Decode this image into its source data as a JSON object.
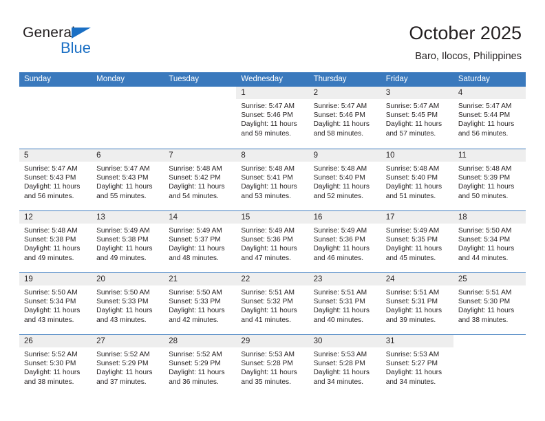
{
  "brand": {
    "name_part1": "General",
    "name_part2": "Blue",
    "triangle_color": "#1a6fc4",
    "text_color": "#231f20"
  },
  "header": {
    "title": "October 2025",
    "subtitle": "Baro, Ilocos, Philippines"
  },
  "theme": {
    "header_bar_color": "#3a79bd",
    "daynum_band_color": "#eeeeee",
    "text_color": "#231f20",
    "cell_background": "#ffffff"
  },
  "calendar": {
    "weekdays": [
      "Sunday",
      "Monday",
      "Tuesday",
      "Wednesday",
      "Thursday",
      "Friday",
      "Saturday"
    ],
    "labels": {
      "sunrise": "Sunrise:",
      "sunset": "Sunset:",
      "daylight": "Daylight:"
    },
    "weeks": [
      [
        {
          "day": "",
          "sunrise": "",
          "sunset": "",
          "daylight_line1": "",
          "daylight_line2": ""
        },
        {
          "day": "",
          "sunrise": "",
          "sunset": "",
          "daylight_line1": "",
          "daylight_line2": ""
        },
        {
          "day": "",
          "sunrise": "",
          "sunset": "",
          "daylight_line1": "",
          "daylight_line2": ""
        },
        {
          "day": "1",
          "sunrise": "Sunrise: 5:47 AM",
          "sunset": "Sunset: 5:46 PM",
          "daylight_line1": "Daylight: 11 hours",
          "daylight_line2": "and 59 minutes."
        },
        {
          "day": "2",
          "sunrise": "Sunrise: 5:47 AM",
          "sunset": "Sunset: 5:46 PM",
          "daylight_line1": "Daylight: 11 hours",
          "daylight_line2": "and 58 minutes."
        },
        {
          "day": "3",
          "sunrise": "Sunrise: 5:47 AM",
          "sunset": "Sunset: 5:45 PM",
          "daylight_line1": "Daylight: 11 hours",
          "daylight_line2": "and 57 minutes."
        },
        {
          "day": "4",
          "sunrise": "Sunrise: 5:47 AM",
          "sunset": "Sunset: 5:44 PM",
          "daylight_line1": "Daylight: 11 hours",
          "daylight_line2": "and 56 minutes."
        }
      ],
      [
        {
          "day": "5",
          "sunrise": "Sunrise: 5:47 AM",
          "sunset": "Sunset: 5:43 PM",
          "daylight_line1": "Daylight: 11 hours",
          "daylight_line2": "and 56 minutes."
        },
        {
          "day": "6",
          "sunrise": "Sunrise: 5:47 AM",
          "sunset": "Sunset: 5:43 PM",
          "daylight_line1": "Daylight: 11 hours",
          "daylight_line2": "and 55 minutes."
        },
        {
          "day": "7",
          "sunrise": "Sunrise: 5:48 AM",
          "sunset": "Sunset: 5:42 PM",
          "daylight_line1": "Daylight: 11 hours",
          "daylight_line2": "and 54 minutes."
        },
        {
          "day": "8",
          "sunrise": "Sunrise: 5:48 AM",
          "sunset": "Sunset: 5:41 PM",
          "daylight_line1": "Daylight: 11 hours",
          "daylight_line2": "and 53 minutes."
        },
        {
          "day": "9",
          "sunrise": "Sunrise: 5:48 AM",
          "sunset": "Sunset: 5:40 PM",
          "daylight_line1": "Daylight: 11 hours",
          "daylight_line2": "and 52 minutes."
        },
        {
          "day": "10",
          "sunrise": "Sunrise: 5:48 AM",
          "sunset": "Sunset: 5:40 PM",
          "daylight_line1": "Daylight: 11 hours",
          "daylight_line2": "and 51 minutes."
        },
        {
          "day": "11",
          "sunrise": "Sunrise: 5:48 AM",
          "sunset": "Sunset: 5:39 PM",
          "daylight_line1": "Daylight: 11 hours",
          "daylight_line2": "and 50 minutes."
        }
      ],
      [
        {
          "day": "12",
          "sunrise": "Sunrise: 5:48 AM",
          "sunset": "Sunset: 5:38 PM",
          "daylight_line1": "Daylight: 11 hours",
          "daylight_line2": "and 49 minutes."
        },
        {
          "day": "13",
          "sunrise": "Sunrise: 5:49 AM",
          "sunset": "Sunset: 5:38 PM",
          "daylight_line1": "Daylight: 11 hours",
          "daylight_line2": "and 49 minutes."
        },
        {
          "day": "14",
          "sunrise": "Sunrise: 5:49 AM",
          "sunset": "Sunset: 5:37 PM",
          "daylight_line1": "Daylight: 11 hours",
          "daylight_line2": "and 48 minutes."
        },
        {
          "day": "15",
          "sunrise": "Sunrise: 5:49 AM",
          "sunset": "Sunset: 5:36 PM",
          "daylight_line1": "Daylight: 11 hours",
          "daylight_line2": "and 47 minutes."
        },
        {
          "day": "16",
          "sunrise": "Sunrise: 5:49 AM",
          "sunset": "Sunset: 5:36 PM",
          "daylight_line1": "Daylight: 11 hours",
          "daylight_line2": "and 46 minutes."
        },
        {
          "day": "17",
          "sunrise": "Sunrise: 5:49 AM",
          "sunset": "Sunset: 5:35 PM",
          "daylight_line1": "Daylight: 11 hours",
          "daylight_line2": "and 45 minutes."
        },
        {
          "day": "18",
          "sunrise": "Sunrise: 5:50 AM",
          "sunset": "Sunset: 5:34 PM",
          "daylight_line1": "Daylight: 11 hours",
          "daylight_line2": "and 44 minutes."
        }
      ],
      [
        {
          "day": "19",
          "sunrise": "Sunrise: 5:50 AM",
          "sunset": "Sunset: 5:34 PM",
          "daylight_line1": "Daylight: 11 hours",
          "daylight_line2": "and 43 minutes."
        },
        {
          "day": "20",
          "sunrise": "Sunrise: 5:50 AM",
          "sunset": "Sunset: 5:33 PM",
          "daylight_line1": "Daylight: 11 hours",
          "daylight_line2": "and 43 minutes."
        },
        {
          "day": "21",
          "sunrise": "Sunrise: 5:50 AM",
          "sunset": "Sunset: 5:33 PM",
          "daylight_line1": "Daylight: 11 hours",
          "daylight_line2": "and 42 minutes."
        },
        {
          "day": "22",
          "sunrise": "Sunrise: 5:51 AM",
          "sunset": "Sunset: 5:32 PM",
          "daylight_line1": "Daylight: 11 hours",
          "daylight_line2": "and 41 minutes."
        },
        {
          "day": "23",
          "sunrise": "Sunrise: 5:51 AM",
          "sunset": "Sunset: 5:31 PM",
          "daylight_line1": "Daylight: 11 hours",
          "daylight_line2": "and 40 minutes."
        },
        {
          "day": "24",
          "sunrise": "Sunrise: 5:51 AM",
          "sunset": "Sunset: 5:31 PM",
          "daylight_line1": "Daylight: 11 hours",
          "daylight_line2": "and 39 minutes."
        },
        {
          "day": "25",
          "sunrise": "Sunrise: 5:51 AM",
          "sunset": "Sunset: 5:30 PM",
          "daylight_line1": "Daylight: 11 hours",
          "daylight_line2": "and 38 minutes."
        }
      ],
      [
        {
          "day": "26",
          "sunrise": "Sunrise: 5:52 AM",
          "sunset": "Sunset: 5:30 PM",
          "daylight_line1": "Daylight: 11 hours",
          "daylight_line2": "and 38 minutes."
        },
        {
          "day": "27",
          "sunrise": "Sunrise: 5:52 AM",
          "sunset": "Sunset: 5:29 PM",
          "daylight_line1": "Daylight: 11 hours",
          "daylight_line2": "and 37 minutes."
        },
        {
          "day": "28",
          "sunrise": "Sunrise: 5:52 AM",
          "sunset": "Sunset: 5:29 PM",
          "daylight_line1": "Daylight: 11 hours",
          "daylight_line2": "and 36 minutes."
        },
        {
          "day": "29",
          "sunrise": "Sunrise: 5:53 AM",
          "sunset": "Sunset: 5:28 PM",
          "daylight_line1": "Daylight: 11 hours",
          "daylight_line2": "and 35 minutes."
        },
        {
          "day": "30",
          "sunrise": "Sunrise: 5:53 AM",
          "sunset": "Sunset: 5:28 PM",
          "daylight_line1": "Daylight: 11 hours",
          "daylight_line2": "and 34 minutes."
        },
        {
          "day": "31",
          "sunrise": "Sunrise: 5:53 AM",
          "sunset": "Sunset: 5:27 PM",
          "daylight_line1": "Daylight: 11 hours",
          "daylight_line2": "and 34 minutes."
        },
        {
          "day": "",
          "sunrise": "",
          "sunset": "",
          "daylight_line1": "",
          "daylight_line2": ""
        }
      ]
    ]
  }
}
